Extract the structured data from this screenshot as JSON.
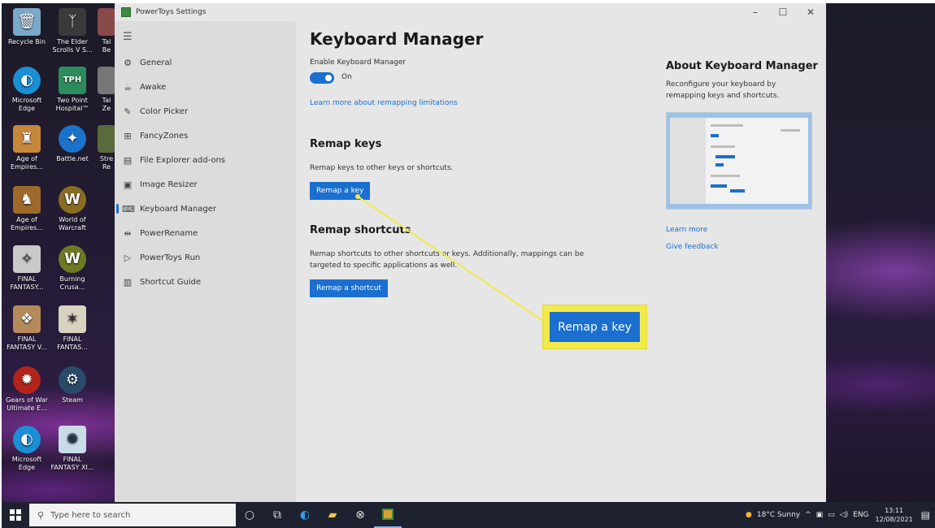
{
  "desktop": {
    "icons": [
      {
        "label": "Recycle Bin",
        "glyph": "🗑",
        "color": "#7aa8c8"
      },
      {
        "label": "The Elder Scrolls V S...",
        "glyph": "ᛉ",
        "color": "#3a3a3a"
      },
      {
        "label": "Microsoft Edge",
        "glyph": "◐",
        "color": "#1b8fd6"
      },
      {
        "label": "Two Point Hospital™",
        "glyph": "TPH",
        "color": "#2d8c5c"
      },
      {
        "label": "Age of Empires...",
        "glyph": "♜",
        "color": "#c7873a"
      },
      {
        "label": "Battle.net",
        "glyph": "✦",
        "color": "#1a72c9"
      },
      {
        "label": "Age of Empires...",
        "glyph": "♞",
        "color": "#9d6a2c"
      },
      {
        "label": "World of Warcraft",
        "glyph": "W",
        "color": "#8a6d22"
      },
      {
        "label": "FINAL FANTASY...",
        "glyph": "✧",
        "color": "#c9c9c9"
      },
      {
        "label": "Burning Crusa...",
        "glyph": "W",
        "color": "#6d7a23"
      },
      {
        "label": "FINAL FANTASY V...",
        "glyph": "❖",
        "color": "#b48a5a"
      },
      {
        "label": "FINAL FANTAS...",
        "glyph": "✶",
        "color": "#d8d2c0"
      },
      {
        "label": "Gears of War Ultimate E...",
        "glyph": "✹",
        "color": "#b3241b"
      },
      {
        "label": "Steam",
        "glyph": "⚙",
        "color": "#2a4a6a"
      },
      {
        "label": "Microsoft Edge",
        "glyph": "◐",
        "color": "#1b8fd6"
      },
      {
        "label": "FINAL FANTASY XI...",
        "glyph": "✺",
        "color": "#c8dce8"
      }
    ],
    "partial_labels": [
      "Tal Be",
      "Tal Ze",
      "Stre Re"
    ]
  },
  "window": {
    "title": "PowerToys Settings",
    "controls": {
      "minimize": "–",
      "maximize": "☐",
      "close": "✕"
    }
  },
  "sidebar": {
    "menu_icon": "☰",
    "items": [
      {
        "label": "General",
        "icon": "gear-icon",
        "glyph": "⚙"
      },
      {
        "label": "Awake",
        "icon": "cup-icon",
        "glyph": "☕"
      },
      {
        "label": "Color Picker",
        "icon": "eyedropper-icon",
        "glyph": "✎"
      },
      {
        "label": "FancyZones",
        "icon": "grid-icon",
        "glyph": "⊞"
      },
      {
        "label": "File Explorer add-ons",
        "icon": "file-explorer-icon",
        "glyph": "▤"
      },
      {
        "label": "Image Resizer",
        "icon": "image-icon",
        "glyph": "▣"
      },
      {
        "label": "Keyboard Manager",
        "icon": "keyboard-icon",
        "glyph": "⌨"
      },
      {
        "label": "PowerRename",
        "icon": "rename-icon",
        "glyph": "⇹"
      },
      {
        "label": "PowerToys Run",
        "icon": "run-icon",
        "glyph": "▷"
      },
      {
        "label": "Shortcut Guide",
        "icon": "shortcut-icon",
        "glyph": "▥"
      }
    ],
    "selected_index": 6
  },
  "main": {
    "title": "Keyboard Manager",
    "enable_label": "Enable Keyboard Manager",
    "toggle_state": "On",
    "learn_limitations": "Learn more about remapping limitations",
    "remap_keys": {
      "title": "Remap keys",
      "description": "Remap keys to other keys or shortcuts.",
      "button": "Remap a key"
    },
    "remap_shortcuts": {
      "title": "Remap shortcuts",
      "description": "Remap shortcuts to other shortcuts or keys. Additionally, mappings can be targeted to specific applications as well.",
      "button": "Remap a shortcut"
    }
  },
  "about": {
    "title": "About Keyboard Manager",
    "description": "Reconfigure your keyboard by remapping keys and shortcuts.",
    "learn_more": "Learn more",
    "feedback": "Give feedback"
  },
  "callout": {
    "label": "Remap a key"
  },
  "taskbar": {
    "search_placeholder": "Type here to search",
    "weather": "18°C  Sunny",
    "language": "ENG",
    "time": "13:11",
    "date": "12/08/2021"
  },
  "colors": {
    "accent": "#1a6fd0",
    "callout": "#f2ea4a"
  }
}
